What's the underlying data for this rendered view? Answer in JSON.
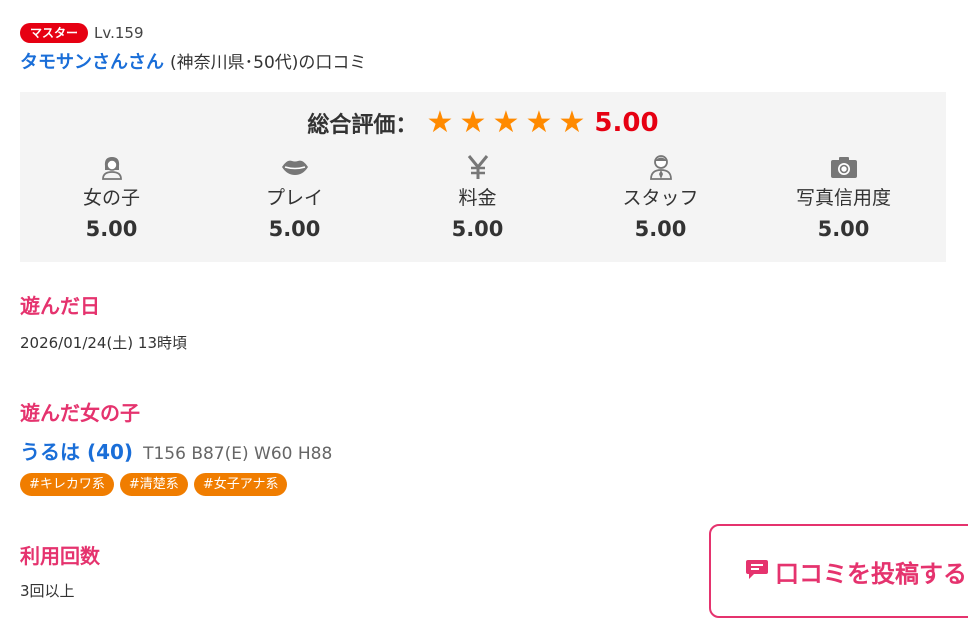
{
  "reviewer": {
    "rank_badge": "マスター",
    "level": "Lv.159",
    "name": "タモサンさんさん",
    "info": "(神奈川県･50代)の口コミ"
  },
  "rating": {
    "overall_label": "総合評価：",
    "stars": [
      "★",
      "★",
      "★",
      "★",
      "★"
    ],
    "overall_score": "5.00",
    "categories": [
      {
        "label": "女の子",
        "score": "5.00",
        "icon": "girl-icon"
      },
      {
        "label": "プレイ",
        "score": "5.00",
        "icon": "lips-icon"
      },
      {
        "label": "料金",
        "score": "5.00",
        "icon": "yen-icon"
      },
      {
        "label": "スタッフ",
        "score": "5.00",
        "icon": "staff-icon"
      },
      {
        "label": "写真信用度",
        "score": "5.00",
        "icon": "camera-icon"
      }
    ]
  },
  "visit_date": {
    "title": "遊んだ日",
    "value": "2026/01/24(土) 13時頃"
  },
  "girl": {
    "title": "遊んだ女の子",
    "name": "うるは (40)",
    "specs": "T156 B87(E) W60 H88",
    "tags": [
      "#キレカワ系",
      "#清楚系",
      "#女子アナ系"
    ]
  },
  "usage": {
    "title": "利用回数",
    "value": "3回以上"
  },
  "post_button": {
    "label": "口コミを投稿する",
    "icon": "comment-icon"
  },
  "colors": {
    "accent_pink": "#e5336e",
    "link_blue": "#1a6ed8",
    "star_orange": "#ff8a00",
    "score_red": "#e60012",
    "tag_orange": "#f07d00"
  }
}
